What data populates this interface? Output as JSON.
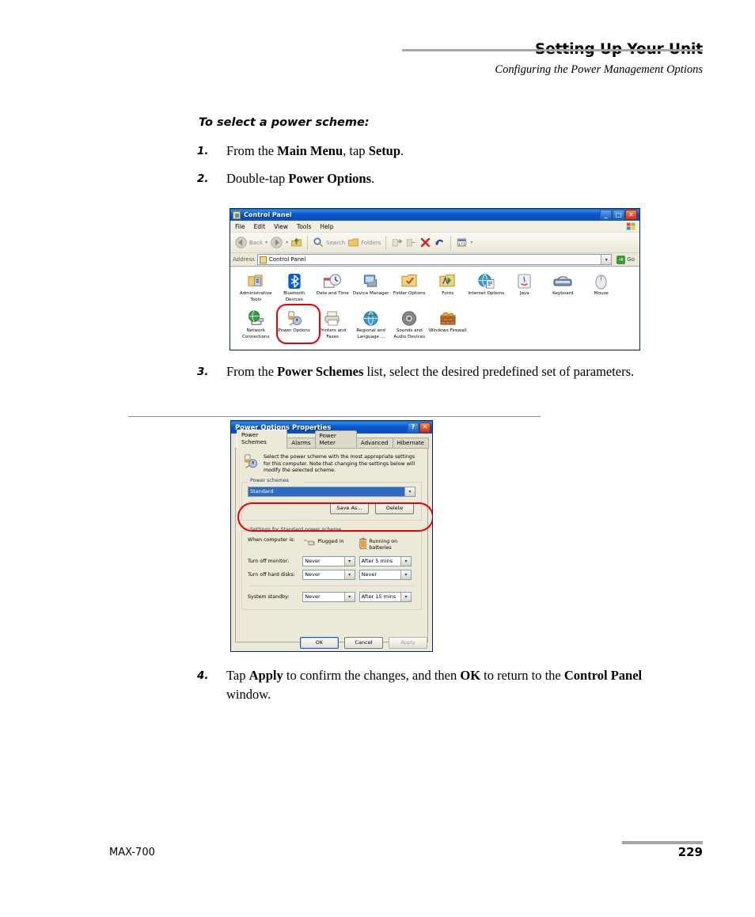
{
  "header": {
    "title": "Setting Up Your Unit",
    "subtitle": "Configuring the Power Management Options"
  },
  "section": {
    "heading": "To select a power scheme:"
  },
  "steps": [
    {
      "num": "1.",
      "html": "From the <b>Main Menu</b>, tap <b>Setup</b>."
    },
    {
      "num": "2.",
      "html": "Double-tap <b>Power Options</b>."
    },
    {
      "num": "3.",
      "html": "From the <b>Power Schemes</b> list, select the desired predefined set of parameters."
    },
    {
      "num": "4.",
      "html": "Tap <b>Apply</b> to confirm the changes, and then <b>OK</b> to return to the <b>Control Panel</b> window."
    }
  ],
  "footer": {
    "left": "MAX-700",
    "page": "229"
  },
  "control_panel": {
    "title": "Control Panel",
    "window_buttons": {
      "minimize": "_",
      "maximize": "□",
      "close": "✕"
    },
    "menus": [
      "File",
      "Edit",
      "View",
      "Tools",
      "Help"
    ],
    "toolbar": {
      "back": "Back",
      "search": "Search",
      "folders": "Folders"
    },
    "address": {
      "label": "Address",
      "value": "Control Panel",
      "go_label": "Go"
    },
    "icons_row1": [
      {
        "label": "Administrative Tools",
        "icon": "administrative-tools-icon"
      },
      {
        "label": "Bluetooth Devices",
        "icon": "bluetooth-icon"
      },
      {
        "label": "Date and Time",
        "icon": "date-time-icon"
      },
      {
        "label": "Device Manager",
        "icon": "device-manager-icon"
      },
      {
        "label": "Folder Options",
        "icon": "folder-options-icon"
      },
      {
        "label": "Fonts",
        "icon": "fonts-icon"
      },
      {
        "label": "Internet Options",
        "icon": "internet-options-icon"
      },
      {
        "label": "Java",
        "icon": "java-icon"
      },
      {
        "label": "Keyboard",
        "icon": "keyboard-icon"
      },
      {
        "label": "Mouse",
        "icon": "mouse-icon"
      }
    ],
    "icons_row2": [
      {
        "label": "Network Connections",
        "icon": "network-connections-icon"
      },
      {
        "label": "Power Options",
        "icon": "power-options-icon"
      },
      {
        "label": "Printers and Faxes",
        "icon": "printers-faxes-icon"
      },
      {
        "label": "Regional and Language ...",
        "icon": "regional-language-icon"
      },
      {
        "label": "Sounds and Audio Devices",
        "icon": "sounds-audio-icon"
      },
      {
        "label": "Windows Firewall",
        "icon": "windows-firewall-icon"
      }
    ],
    "annotation_color": "#ee0000"
  },
  "power_dialog": {
    "title": "Power Options Properties",
    "window_buttons": {
      "help": "?",
      "close": "✕"
    },
    "tabs": [
      {
        "label": "Power Schemes",
        "active": true
      },
      {
        "label": "Alarms",
        "active": false
      },
      {
        "label": "Power Meter",
        "active": false
      },
      {
        "label": "Advanced",
        "active": false
      },
      {
        "label": "Hibernate",
        "active": false
      }
    ],
    "intro_text": "Select the power scheme with the most appropriate settings for this computer. Note that changing the settings below will modify the selected scheme.",
    "power_schemes": {
      "group_title": "Power schemes",
      "selected": "Standard",
      "save_as_label": "Save As...",
      "delete_label": "Delete"
    },
    "settings": {
      "group_title": "Settings for Standard power scheme",
      "when_label": "When computer is:",
      "col_plugged": "Plugged in",
      "col_battery": "Running on batteries",
      "rows": [
        {
          "label": "Turn off monitor:",
          "plugged": "Never",
          "battery": "After 5 mins"
        },
        {
          "label": "Turn off hard disks:",
          "plugged": "Never",
          "battery": "Never"
        },
        {
          "label": "System standby:",
          "plugged": "Never",
          "battery": "After 15 mins"
        }
      ]
    },
    "buttons": {
      "ok": "OK",
      "cancel": "Cancel",
      "apply": "Apply"
    },
    "annotation_color": "#ee0000"
  }
}
